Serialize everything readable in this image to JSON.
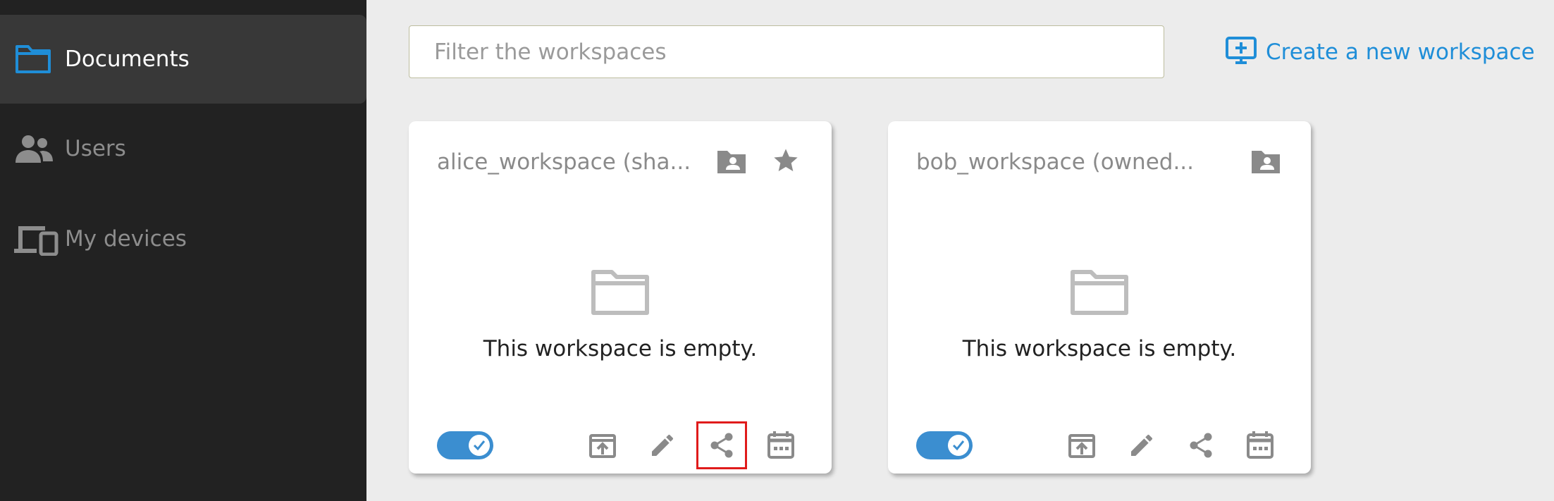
{
  "sidebar": {
    "items": [
      {
        "label": "Documents",
        "icon": "folder-icon",
        "active": true
      },
      {
        "label": "Users",
        "icon": "users-icon",
        "active": false
      },
      {
        "label": "My devices",
        "icon": "devices-icon",
        "active": false
      }
    ]
  },
  "toolbar": {
    "filter_placeholder": "Filter the workspaces",
    "create_label": "Create a new workspace",
    "create_icon": "add-workspace-icon"
  },
  "workspaces": [
    {
      "title": "alice_workspace (sha...",
      "empty_text": "This workspace is empty.",
      "starred": true,
      "toggle_on": true,
      "actions": [
        "mount-icon",
        "rename-icon",
        "share-icon",
        "calendar-icon"
      ],
      "highlighted_action": "share-icon"
    },
    {
      "title": "bob_workspace (owned...",
      "empty_text": "This workspace is empty.",
      "starred": false,
      "toggle_on": true,
      "actions": [
        "mount-icon",
        "rename-icon",
        "share-icon",
        "calendar-icon"
      ]
    }
  ],
  "colors": {
    "accent": "#1f8ed8",
    "sidebar_bg": "#222222",
    "highlight": "#e01b1b",
    "icon_grey": "#8a8a8a"
  }
}
